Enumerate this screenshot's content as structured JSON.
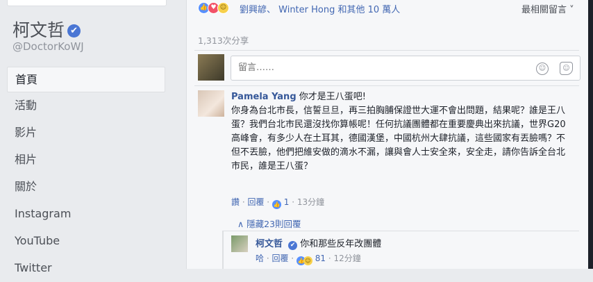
{
  "sidebar": {
    "page_name": "柯文哲",
    "verified_symbol": "✔",
    "handle": "@DoctorKoWJ",
    "items": [
      {
        "label": "首頁",
        "active": true
      },
      {
        "label": "活動"
      },
      {
        "label": "影片"
      },
      {
        "label": "相片"
      },
      {
        "label": "關於"
      },
      {
        "label": "Instagram"
      },
      {
        "label": "YouTube"
      },
      {
        "label": "Twitter"
      }
    ]
  },
  "post": {
    "reaction_names": "劉興諺、 Winter Hong 和其他 10 萬人",
    "sort_label": "最相關留言 ˅",
    "shares": "1,313次分享",
    "comment_placeholder": "留言……"
  },
  "comment": {
    "author": "Pamela Yang",
    "first_line": "你才是王八蛋吧!",
    "text": "你身為台北市長，信誓旦旦，再三拍胸脯保證世大運不會出問題，結果呢？誰是王八蛋？我們台北市民還沒找你算帳呢！任何抗議團體都在重要慶典出來抗議，世界G20高峰會，有多少人在土耳其，德國漢堡，中國杭州大肆抗議，這些國家有丟臉嗎？不但不丟臉，他們把維安做的滴水不漏，讓與會人士安全來，安全走，請你告訴全台北市民，誰是王八蛋？",
    "like": "讚",
    "reply": "回覆",
    "reaction_count": "1",
    "time": "13分鐘",
    "hidden_replies": "隱藏23則回覆"
  },
  "reply": {
    "author": "柯文哲",
    "text": "你和那些反年改團體",
    "like": "哈",
    "reply": "回覆",
    "reaction_count": "81",
    "time": "12分鐘"
  }
}
